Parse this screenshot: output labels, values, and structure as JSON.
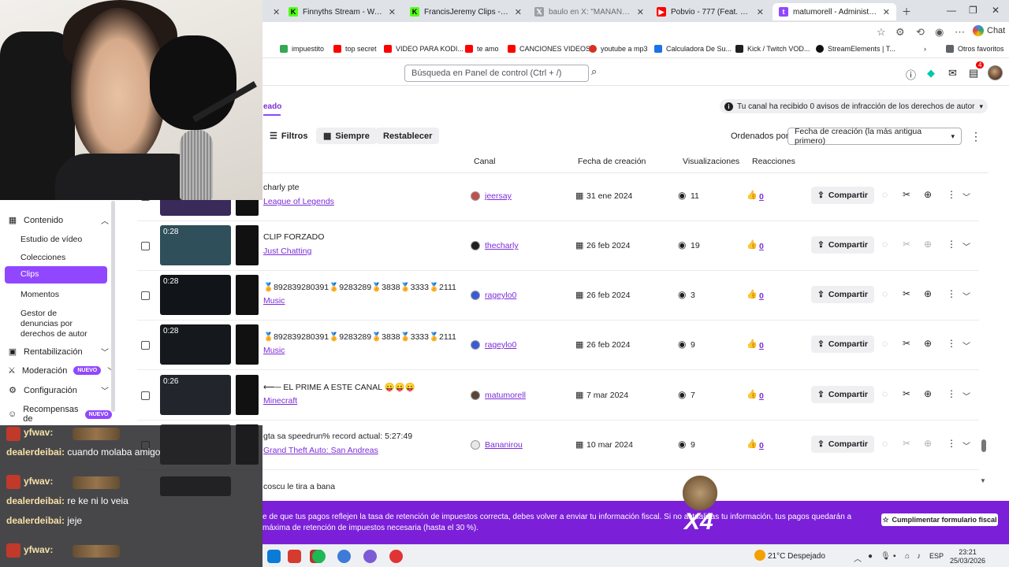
{
  "browser": {
    "tabs": [
      {
        "title": "Finnyths Stream - Watch Live",
        "favicon_color": "#53fc18",
        "icon": "kick-icon"
      },
      {
        "title": "FrancisJeremy Clips - Watch Live",
        "favicon_color": "#53fc18",
        "icon": "kick-icon"
      },
      {
        "title": "baulo en X: \"MAÑANA 26 DE MA",
        "favicon_color": "#9aa0a6",
        "icon": "x-icon"
      },
      {
        "title": "Pobvio - 777 (Feat. Francis Jerem",
        "favicon_color": "#ff0000",
        "icon": "youtube-icon"
      },
      {
        "title": "matumorell - Administrador de c",
        "favicon_color": "#9147ff",
        "icon": "twitch-icon"
      }
    ],
    "chat_label": "Chat",
    "bookmarks": [
      {
        "label": "impuestito",
        "color": "#34a853"
      },
      {
        "label": "top secret",
        "color": "#ff0000"
      },
      {
        "label": "VIDEO PARA KODI...",
        "color": "#ff0000"
      },
      {
        "label": "te amo",
        "color": "#ff0000"
      },
      {
        "label": "CANCIONES VIDEOS",
        "color": "#ff0000"
      },
      {
        "label": "youtube a mp3",
        "color": "#d93025"
      },
      {
        "label": "Calculadora De Su...",
        "color": "#1a73e8"
      },
      {
        "label": "Kick / Twitch VOD...",
        "color": "#1f1f1f"
      },
      {
        "label": "StreamElements | T...",
        "color": "#111111"
      }
    ],
    "other_bookmarks": "Otros favoritos"
  },
  "header": {
    "search_placeholder": "Búsqueda en Panel de control (Ctrl + /)",
    "notification_count": "4"
  },
  "sidebar": {
    "content_label": "Contenido",
    "items": [
      "Estudio de vídeo",
      "Colecciones",
      "Clips",
      "Momentos",
      "Gestor de denuncias por derechos de autor"
    ],
    "active_item": "Clips",
    "monetization": "Rentabilización",
    "moderation": "Moderación",
    "new_badge": "NUEVO",
    "settings": "Configuración",
    "rewards": "Recompensas de"
  },
  "toolbar": {
    "current_tab": "eado",
    "copyright_notice": "Tu canal ha recibido 0 avisos de infracción de los derechos de autor",
    "filters_label": "Filtros",
    "always_label": "Siempre",
    "reset_label": "Restablecer",
    "sort_label": "Ordenados por",
    "sort_value": "Fecha de creación (la más antigua primero)"
  },
  "table": {
    "columns": {
      "channel": "Canal",
      "created": "Fecha de creación",
      "views": "Visualizaciones",
      "reactions": "Reacciones"
    },
    "share_label": "Compartir",
    "rows": [
      {
        "duration": "",
        "title": "charly pte",
        "game": "League of Legends",
        "channel": "jeersay",
        "avatar_color": "#c0504d",
        "date": "31 ene 2024",
        "views": "11",
        "likes": "0",
        "thumb": "#3a2a5a",
        "clip_enabled": true
      },
      {
        "duration": "0:28",
        "title": "CLIP FORZADO",
        "game": "Just Chatting",
        "channel": "thecharly",
        "avatar_color": "#1f1f1f",
        "date": "26 feb 2024",
        "views": "19",
        "likes": "0",
        "thumb": "#2f4f5a",
        "clip_enabled": false
      },
      {
        "duration": "0:28",
        "title": "🏅892839280391🏅9283289🏅3838🏅3333🏅2111...",
        "game": "Music",
        "channel": "rageylo0",
        "avatar_color": "#3a5bd9",
        "date": "26 feb 2024",
        "views": "3",
        "likes": "0",
        "thumb": "#111418",
        "clip_enabled": true
      },
      {
        "duration": "0:28",
        "title": "🏅892839280391🏅9283289🏅3838🏅3333🏅2111...",
        "game": "Music",
        "channel": "rageylo0",
        "avatar_color": "#3a5bd9",
        "date": "26 feb 2024",
        "views": "9",
        "likes": "0",
        "thumb": "#15181c",
        "clip_enabled": true
      },
      {
        "duration": "0:26",
        "title": "⟵─ EL PRIME A ESTE CANAL 😛😛😛",
        "game": "Minecraft",
        "channel": "matumorell",
        "avatar_color": "#5a4636",
        "date": "7 mar 2024",
        "views": "7",
        "likes": "0",
        "thumb": "#22262c",
        "clip_enabled": true
      },
      {
        "duration": "",
        "title": "gta sa speedrun% record actual: 5:27:49",
        "game": "Grand Theft Auto: San Andreas",
        "channel": "Bananirou",
        "avatar_color": "#e8e8e8",
        "date": "10 mar 2024",
        "views": "9",
        "likes": "0",
        "thumb": "#444",
        "clip_enabled": false
      }
    ],
    "partial_title": "coscu le tira a bana"
  },
  "tax_banner": {
    "text": "e de que tus pagos reflejen la tasa de retención de impuestos correcta, debes volver a enviar tu información fiscal. Si no actualizas tu información, tus pagos quedarán a máxima de retención de impuestos necesaria (hasta el 30 %).",
    "cta": "Cumplimentar formulario fiscal"
  },
  "overlay": {
    "sticker_text": "X4",
    "chat": [
      {
        "user": "yfwav:",
        "msg": ""
      },
      {
        "user": "dealerdeibai:",
        "msg": "cuando molaba amigo"
      },
      {
        "user": "yfwav:",
        "msg": ""
      },
      {
        "user": "dealerdeibai:",
        "msg": "re ke ni lo veia"
      },
      {
        "user": "dealerdeibai:",
        "msg": "jeje"
      },
      {
        "user": "yfwav:",
        "msg": ""
      }
    ]
  },
  "taskbar": {
    "weather": "21°C  Despejado",
    "lang": "ESP",
    "time": "23:21",
    "date": "25/03/2026"
  }
}
